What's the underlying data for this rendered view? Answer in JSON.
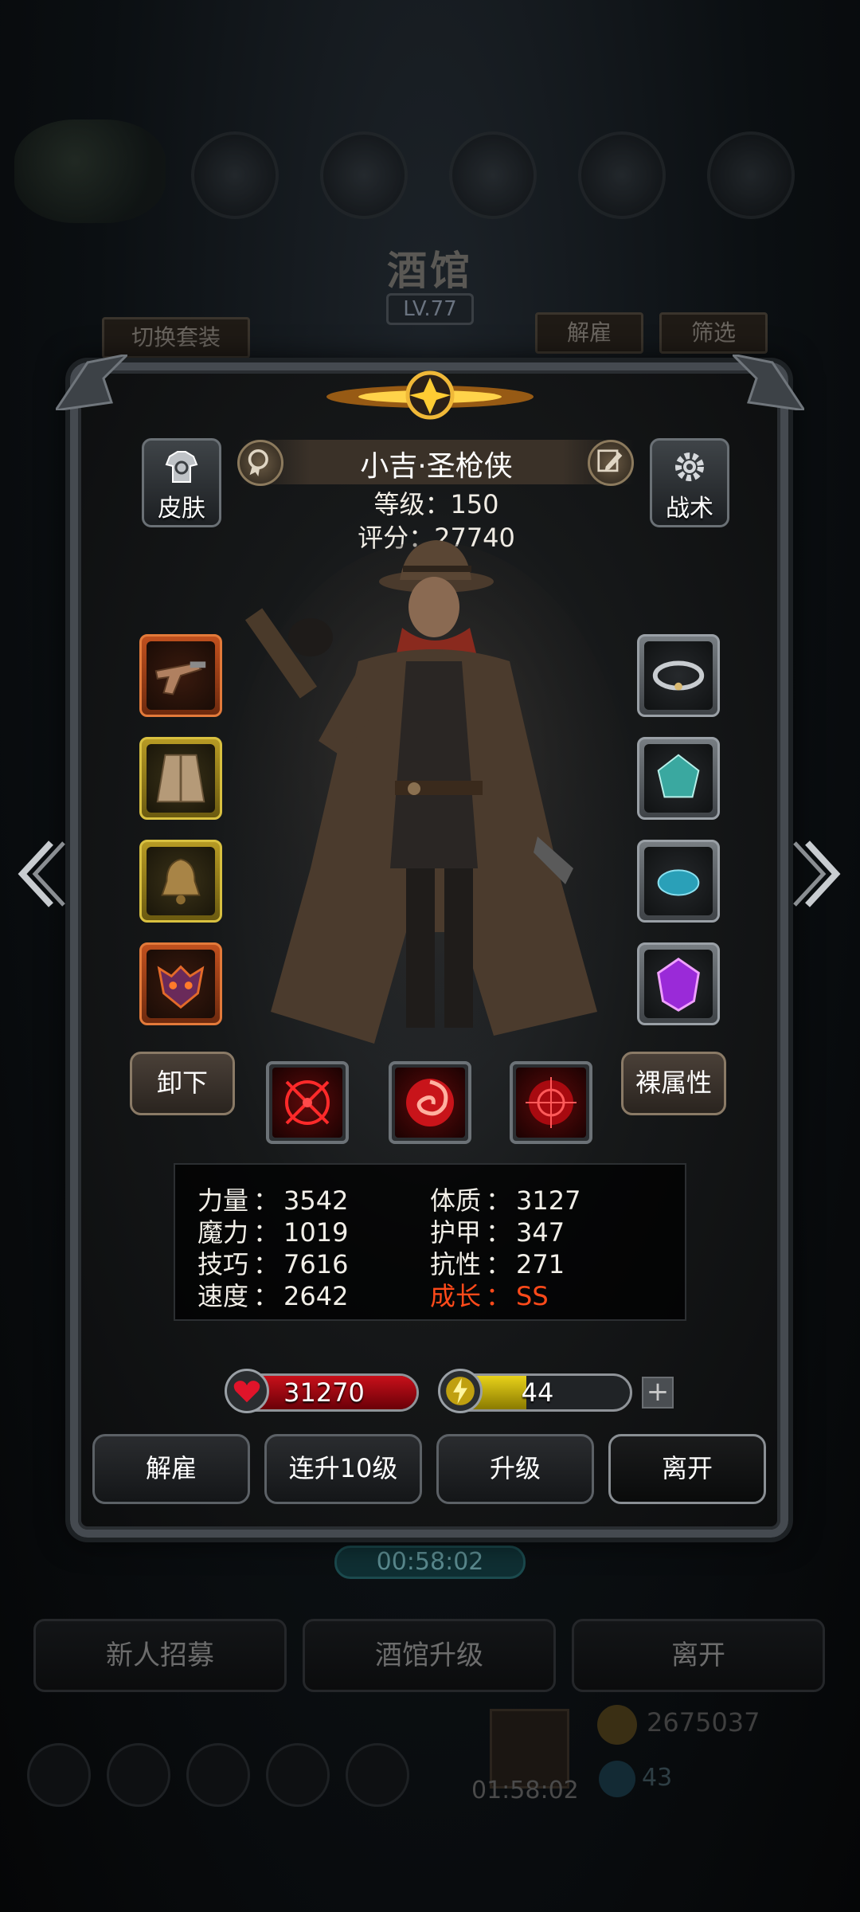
{
  "background": {
    "title": "酒馆",
    "level": "LV.77",
    "tab_switch_outfit": "切换套装",
    "tab_dismiss": "解雇",
    "tab_filter": "筛选",
    "timer": "00:58:02",
    "buttons": [
      "新人招募",
      "酒馆升级",
      "离开"
    ],
    "gift_timer": "01:58:02",
    "gold": "2675037",
    "gems": "43"
  },
  "hero": {
    "name": "小吉·圣枪侠",
    "level_line": "等级：150",
    "score_line": "评分：27740",
    "skin_label": "皮肤",
    "tactics_label": "战术"
  },
  "equipment": {
    "left": [
      {
        "name": "flintlock-pistol",
        "rarity": "orange"
      },
      {
        "name": "fur-coat",
        "rarity": "gold"
      },
      {
        "name": "bronze-bell",
        "rarity": "gold"
      },
      {
        "name": "demon-mask",
        "rarity": "orange"
      }
    ],
    "right": [
      {
        "name": "silver-bracelet",
        "rarity": "gray"
      },
      {
        "name": "teal-crystal",
        "rarity": "gray"
      },
      {
        "name": "turquoise-stone",
        "rarity": "gray"
      },
      {
        "name": "purple-gem",
        "rarity": "gray"
      }
    ]
  },
  "actions": {
    "unequip": "卸下",
    "base_stats": "裸属性"
  },
  "stats": {
    "strength": {
      "label": "力量",
      "value": "3542"
    },
    "magic": {
      "label": "魔力",
      "value": "1019"
    },
    "skill": {
      "label": "技巧",
      "value": "7616"
    },
    "speed": {
      "label": "速度",
      "value": "2642"
    },
    "constitution": {
      "label": "体质",
      "value": "3127"
    },
    "armor": {
      "label": "护甲",
      "value": "347"
    },
    "resistance": {
      "label": "抗性",
      "value": "271"
    },
    "growth": {
      "label": "成长",
      "value": "SS"
    },
    "separator": "："
  },
  "bars": {
    "hp": {
      "value": "31270",
      "fill": 1.0,
      "color": "#c8101a"
    },
    "energy": {
      "value": "44",
      "fill": 0.44,
      "color": "#e8d21a"
    }
  },
  "buttons": {
    "dismiss": "解雇",
    "level_up_10": "连升10级",
    "level_up": "升级",
    "leave": "离开"
  }
}
